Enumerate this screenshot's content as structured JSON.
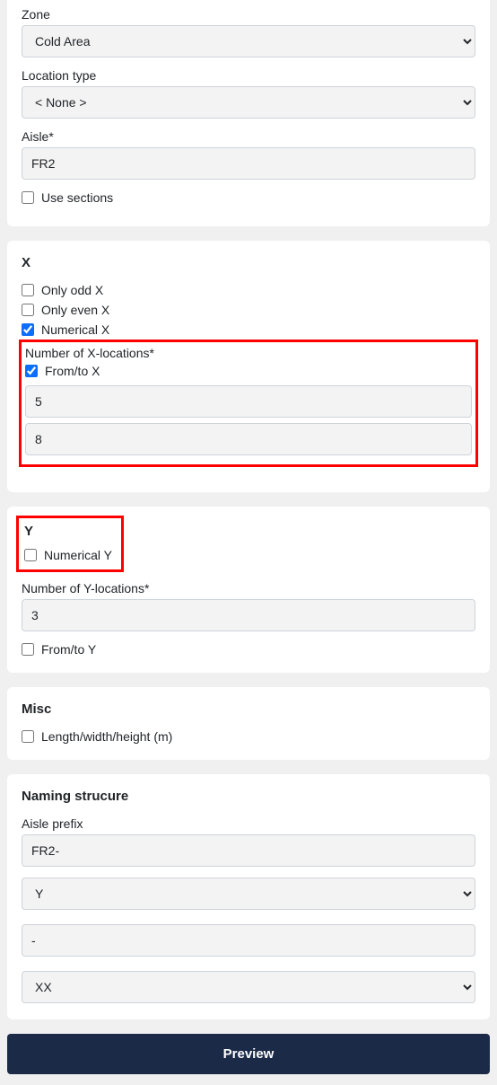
{
  "zone_section": {
    "zone_label": "Zone",
    "zone_value": "Cold Area",
    "location_type_label": "Location type",
    "location_type_value": "< None >",
    "aisle_label": "Aisle*",
    "aisle_value": "FR2",
    "use_sections_label": "Use sections",
    "use_sections_checked": false
  },
  "x_section": {
    "title": "X",
    "only_odd_label": "Only odd X",
    "only_even_label": "Only even X",
    "numerical_label": "Numerical X",
    "num_locations_label": "Number of X-locations*",
    "from_to_label": "From/to X",
    "from_value": "5",
    "to_value": "8"
  },
  "y_section": {
    "title": "Y",
    "numerical_label": "Numerical Y",
    "num_locations_label": "Number of Y-locations*",
    "num_locations_value": "3",
    "from_to_label": "From/to Y"
  },
  "misc_section": {
    "title": "Misc",
    "lwh_label": "Length/width/height (m)"
  },
  "naming_section": {
    "title": "Naming strucure",
    "aisle_prefix_label": "Aisle prefix",
    "aisle_prefix_value": "FR2-",
    "select1_value": "Y",
    "separator_value": "-",
    "select2_value": "XX"
  },
  "preview_button": "Preview"
}
